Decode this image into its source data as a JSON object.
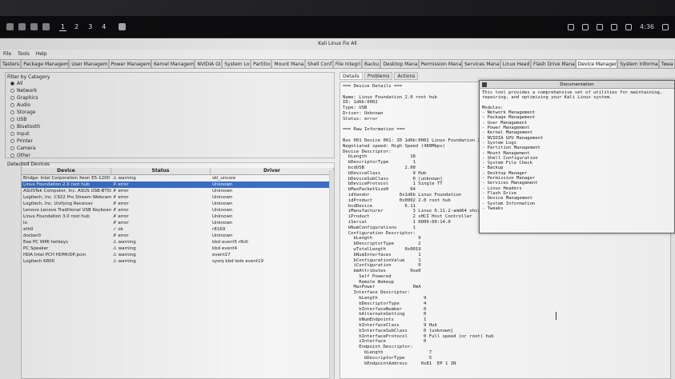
{
  "taskbar": {
    "workspaces": [
      "1",
      "2",
      "3",
      "4"
    ],
    "clock": "4:36"
  },
  "window": {
    "title": "Kali Linux Fix All",
    "menu": [
      "File",
      "Tools",
      "Help"
    ]
  },
  "tabs": [
    "Tasters",
    "Package Managem",
    "User Managem",
    "Power Managem",
    "Kernel Managem",
    "NVIDIA GI",
    "System Lo",
    "Partitio",
    "Mount Mana",
    "Shell Conf",
    "File Integri",
    "Backu",
    "Desktop Mana",
    "Permission Mana",
    "Services Mana",
    "Linux Head",
    "Flash Drive Mana",
    "Device Manager",
    "System Informa",
    "Twea"
  ],
  "filter": {
    "label": "Filter by Category",
    "categories": [
      {
        "label": "All",
        "selected": true
      },
      {
        "label": "Network",
        "selected": false
      },
      {
        "label": "Graphics",
        "selected": false
      },
      {
        "label": "Audio",
        "selected": false
      },
      {
        "label": "Storage",
        "selected": false
      },
      {
        "label": "USB",
        "selected": false
      },
      {
        "label": "Bluetooth",
        "selected": false
      },
      {
        "label": "Input",
        "selected": false
      },
      {
        "label": "Printer",
        "selected": false
      },
      {
        "label": "Camera",
        "selected": false
      },
      {
        "label": "Other",
        "selected": false
      }
    ]
  },
  "devices": {
    "label": "Detected Devices",
    "columns": [
      "Device",
      "Status",
      "Driver"
    ],
    "rows": [
      {
        "device": "Bridge: Intel Corporation Xeon E5-1200 v6/7",
        "status": "⚠ warning",
        "driver": "skl_uncore",
        "selected": false
      },
      {
        "device": "Linux Foundation 2.0 root hub",
        "status": "✗ error",
        "driver": "Unknown",
        "selected": true
      },
      {
        "device": "ASUSTek Computer, Inc. ASUS USB-BT500",
        "status": "✗ error",
        "driver": "Unknown",
        "selected": false
      },
      {
        "device": "Logitech, Inc. C922 Pro Stream Webcam",
        "status": "✗ error",
        "driver": "Unknown",
        "selected": false
      },
      {
        "device": "Logitech, Inc. Unifying Receiver",
        "status": "✗ error",
        "driver": "Unknown",
        "selected": false
      },
      {
        "device": "Lenovo Lenovo Traditional USB Keyboard",
        "status": "✗ error",
        "driver": "Unknown",
        "selected": false
      },
      {
        "device": "Linux Foundation 3.0 root hub",
        "status": "✗ error",
        "driver": "Unknown",
        "selected": false
      },
      {
        "device": "lo",
        "status": "✗ error",
        "driver": "Unknown",
        "selected": false
      },
      {
        "device": "eth0",
        "status": "✓ ok",
        "driver": "r8169",
        "selected": false
      },
      {
        "device": "docker0",
        "status": "✗ error",
        "driver": "Unknown",
        "selected": false
      },
      {
        "device": "Eee PC WMI hotkeys",
        "status": "⚠ warning",
        "driver": "kbd event5 rfkill",
        "selected": false
      },
      {
        "device": "PC Speaker",
        "status": "⚠ warning",
        "driver": "kbd event4",
        "selected": false
      },
      {
        "device": "HDA Intel PCH HDMI/DP,pcm",
        "status": "⚠ warning",
        "driver": "event17",
        "selected": false
      },
      {
        "device": "Logitech K800",
        "status": "⚠ warning",
        "driver": "sysrq kbd leds event19",
        "selected": false
      }
    ]
  },
  "details": {
    "subtabs": [
      "Details",
      "Problems",
      "Actions"
    ],
    "lines": [
      "=== Device Details ===",
      "",
      "Name: Linux Foundation 2.0 root hub",
      "ID: 1d6b:0002",
      "Type: USB",
      "Driver: Unknown",
      "Status: error",
      "",
      "=== Raw Information ===",
      "",
      "Bus 001 Device 001: ID 1d6b:0002 Linux Foundation 2.0 root hub",
      "Negotiated speed: High Speed (480Mbps)",
      "Device Descriptor:",
      "  bLength                18",
      "  bDescriptorType         1",
      "  bcdUSB               2.00",
      "  bDeviceClass            9 Hub",
      "  bDeviceSubClass         0 [unknown]",
      "  bDeviceProtocol         1 Single TT",
      "  bMaxPacketSize0        64",
      "  idVendor           0x1d6b Linux Foundation",
      "  idProduct          0x0002 2.0 root hub",
      "  bcdDevice            6.11",
      "  iManufacturer           3 Linux 6.11.2-amd64 xhci-hcd",
      "  iProduct                2 xHCI Host Controller",
      "  iSerial                 1 0000:00:14.0",
      "  bNumConfigurations      1",
      "  Configuration Descriptor:",
      "    bLength                 9",
      "    bDescriptorType         2",
      "    wTotalLength       0x0019",
      "    bNumInterfaces          1",
      "    bConfigurationValue     1",
      "    iConfiguration          0",
      "    bmAttributes         0xe0",
      "      Self Powered",
      "      Remote Wakeup",
      "    MaxPower              0mA",
      "    Interface Descriptor:",
      "      bLength                 9",
      "      bDescriptorType         4",
      "      bInterfaceNumber        0",
      "      bAlternateSetting       0",
      "      bNumEndpoints           1",
      "      bInterfaceClass         9 Hub",
      "      bInterfaceSubClass      0 [unknown]",
      "      bInterfaceProtocol      0 Full speed (or root) hub",
      "      iInterface              0",
      "      Endpoint Descriptor:",
      "        bLength                 7",
      "        bDescriptorType         5",
      "        bEndpointAddress     0x81  EP 1 IN"
    ]
  },
  "documentation": {
    "title": "Documentation",
    "lines": [
      "This tool provides a comprehensive set of utilities for maintaining,",
      "repairing, and optimizing your Kali Linux system.",
      "",
      "Modules:",
      "- Network Management",
      "- Package Management",
      "- User Management",
      "- Power Management",
      "- Kernel Management",
      "- NVIDIA GPU Management",
      "- System Logs",
      "- Partition Management",
      "- Mount Management",
      "- Shell Configuration",
      "- System File Check",
      "- Backup",
      "- Desktop Manager",
      "- Permission Manager",
      "- Services Management",
      "- Linux Headers",
      "- Flash Drive",
      "- Device Management",
      "- System Information",
      "- Tweaks"
    ]
  }
}
